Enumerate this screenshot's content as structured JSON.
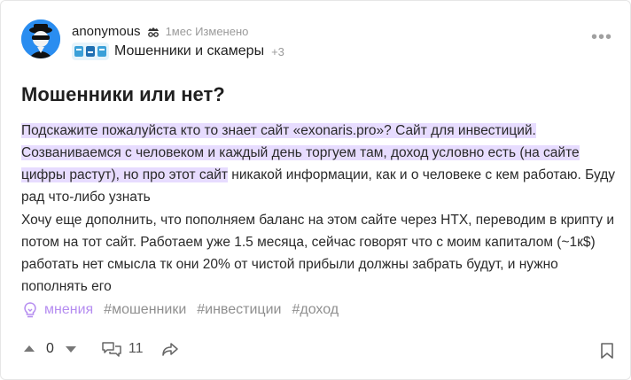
{
  "post": {
    "author": "anonymous",
    "meta": "1мес Изменено",
    "community": "Мошенники и скамеры",
    "community_extra": "+3",
    "title": "Мошенники или нет?",
    "p1": {
      "highlighted": "Подскажите пожалуйста кто то знает сайт «exonaris.pro»? Сайт для инвестиций. Созваниваемся с человеком и каждый день торгуем там, доход условно есть (на сайте цифры растут), но про этот сайт",
      "rest": " никакой информации, как и о человеке с кем работаю. Буду рад что-либо узнать"
    },
    "p2": "Хочу еще дополнить, что пополняем баланс на этом сайте через HTX, переводим в крипту и потом на тот сайт. Работаем уже 1.5 месяца, сейчас говорят что с моим капиталом (~1к$) работать нет смысла тк они 20% от чистой прибыли должны забрать будут, и нужно пополнять его"
  },
  "tags": {
    "opinion_label": "мнения",
    "items": [
      "#мошенники",
      "#инвестиции",
      "#доход"
    ]
  },
  "actions": {
    "votes": "0",
    "comments": "11"
  },
  "colors": {
    "highlight": "#e7dcff",
    "opinion_accent": "#b58df0",
    "avatar_bg": "#2a8df0"
  }
}
